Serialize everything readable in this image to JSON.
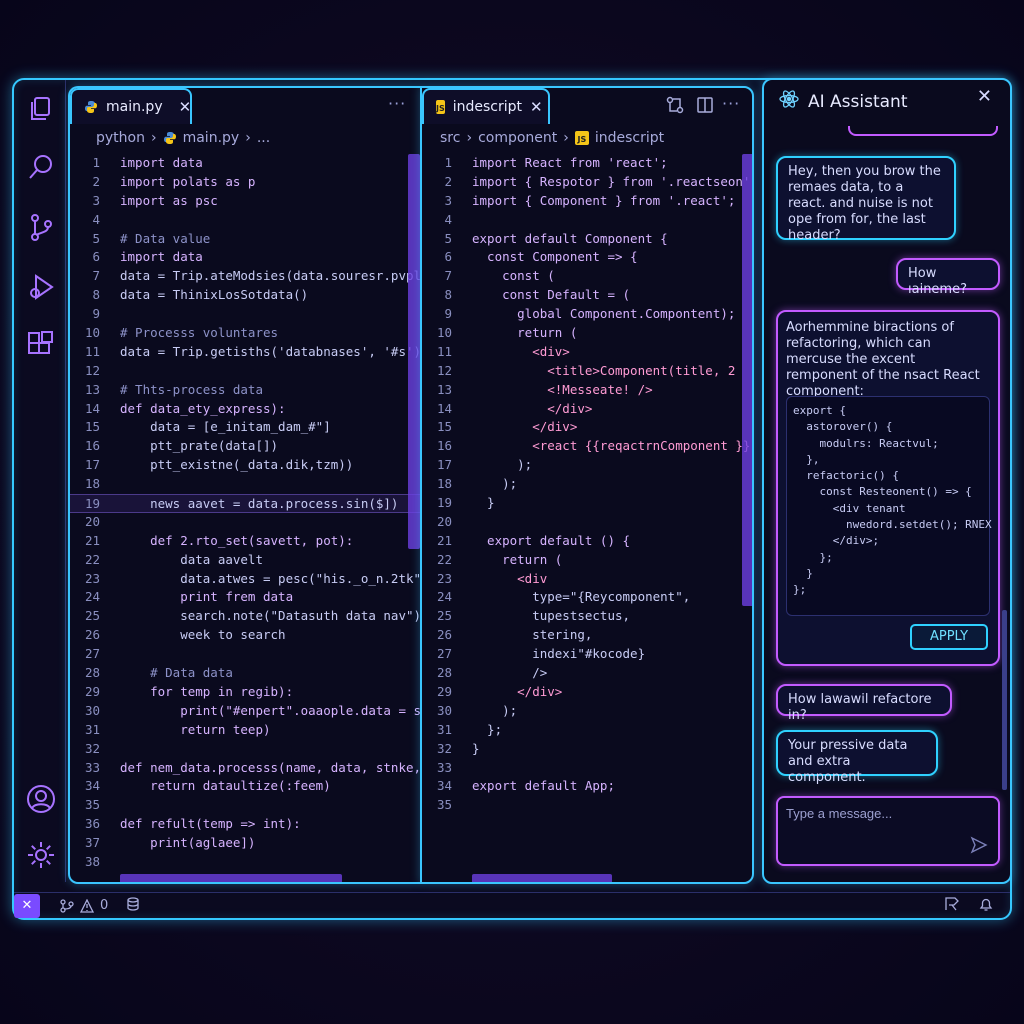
{
  "left_editor": {
    "tab_label": "main.py",
    "close_glyph": "✕",
    "more_glyph": "···",
    "breadcrumb": [
      "python",
      "›",
      "main.py",
      "›",
      "..."
    ],
    "lines": [
      {
        "n": "1",
        "t": "import data"
      },
      {
        "n": "2",
        "t": "import polats as p"
      },
      {
        "n": "3",
        "t": "import as psc"
      },
      {
        "n": "4",
        "t": ""
      },
      {
        "n": "5",
        "t": "# Data value"
      },
      {
        "n": "6",
        "t": "import data"
      },
      {
        "n": "7",
        "t": "data = Trip.ateModsies(data.souresr.pvpl"
      },
      {
        "n": "8",
        "t": "data = ThinixLosSotdata()"
      },
      {
        "n": "9",
        "t": ""
      },
      {
        "n": "10",
        "t": "# Processs voluntares"
      },
      {
        "n": "11",
        "t": "data = Trip.getisths('databnases', '#s')"
      },
      {
        "n": "12",
        "t": ""
      },
      {
        "n": "13",
        "t": "# Thts-process data"
      },
      {
        "n": "14",
        "t": "def data_ety_express):"
      },
      {
        "n": "15",
        "t": "    data = [e_initam_dam_#\"]"
      },
      {
        "n": "16",
        "t": "    ptt_prate(data[])"
      },
      {
        "n": "17",
        "t": "    ptt_existne(_data.dik,tzm))"
      },
      {
        "n": "18",
        "t": ""
      },
      {
        "n": "19",
        "t": "    news aavet = data.process.sin($])"
      },
      {
        "n": "20",
        "t": ""
      },
      {
        "n": "21",
        "t": "    def 2.rto_set(savett, pot):"
      },
      {
        "n": "22",
        "t": "        data aavelt"
      },
      {
        "n": "23",
        "t": "        data.atwes = pesc(\"his._o_n.2tk\""
      },
      {
        "n": "24",
        "t": "        print frem data"
      },
      {
        "n": "25",
        "t": "        search.note(\"Datasuth data nav\")"
      },
      {
        "n": "26",
        "t": "        week to search"
      },
      {
        "n": "27",
        "t": ""
      },
      {
        "n": "28",
        "t": "    # Data data"
      },
      {
        "n": "29",
        "t": "    for temp in regib):"
      },
      {
        "n": "30",
        "t": "        print(\"#enpert\".oaaople.data = str"
      },
      {
        "n": "31",
        "t": "        return teep)"
      },
      {
        "n": "32",
        "t": ""
      },
      {
        "n": "33",
        "t": "def nem_data.processs(name, data, stnke,P"
      },
      {
        "n": "34",
        "t": "    return dataultize(:feem)"
      },
      {
        "n": "35",
        "t": ""
      },
      {
        "n": "36",
        "t": "def refult(temp => int):"
      },
      {
        "n": "37",
        "t": "    print(aglaee])"
      },
      {
        "n": "38",
        "t": ""
      }
    ]
  },
  "right_editor": {
    "tab_label": "indescript",
    "js_badge": "JS",
    "close_glyph": "✕",
    "more_glyph": "···",
    "breadcrumb": [
      "src",
      "›",
      "component",
      "›",
      "indescript"
    ],
    "lines": [
      {
        "n": "1",
        "t": "import React from 'react';"
      },
      {
        "n": "2",
        "t": "import { Respotor } from '.reactseon'"
      },
      {
        "n": "3",
        "t": "import { Component } from '.react';"
      },
      {
        "n": "4",
        "t": ""
      },
      {
        "n": "5",
        "t": "export default Component {"
      },
      {
        "n": "6",
        "t": "  const Component => {"
      },
      {
        "n": "7",
        "t": "    const ("
      },
      {
        "n": "8",
        "t": "    const Default = ("
      },
      {
        "n": "9",
        "t": "      global Component.Compontent);"
      },
      {
        "n": "10",
        "t": "      return ("
      },
      {
        "n": "11",
        "t": "        <div>"
      },
      {
        "n": "12",
        "t": "          <title>Component(title, 2"
      },
      {
        "n": "13",
        "t": "          <!Messeate! />"
      },
      {
        "n": "14",
        "t": "          </div>"
      },
      {
        "n": "15",
        "t": "        </div>"
      },
      {
        "n": "16",
        "t": "        <react {{reqactrnComponent }};"
      },
      {
        "n": "17",
        "t": "      );"
      },
      {
        "n": "18",
        "t": "    );"
      },
      {
        "n": "19",
        "t": "  }"
      },
      {
        "n": "20",
        "t": ""
      },
      {
        "n": "21",
        "t": "  export default () {"
      },
      {
        "n": "22",
        "t": "    return ("
      },
      {
        "n": "23",
        "t": "      <div"
      },
      {
        "n": "24",
        "t": "        type=\"{Reycomponent\","
      },
      {
        "n": "25",
        "t": "        tupestsectus,"
      },
      {
        "n": "26",
        "t": "        stering,"
      },
      {
        "n": "27",
        "t": "        indexi\"#kocode}"
      },
      {
        "n": "28",
        "t": "        />"
      },
      {
        "n": "29",
        "t": "      </div>"
      },
      {
        "n": "30",
        "t": "    );"
      },
      {
        "n": "31",
        "t": "  };"
      },
      {
        "n": "32",
        "t": "}"
      },
      {
        "n": "33",
        "t": ""
      },
      {
        "n": "34",
        "t": "export default App;"
      },
      {
        "n": "35",
        "t": ""
      }
    ]
  },
  "assistant": {
    "title": "AI Assistant",
    "close_glyph": "✕",
    "messages": [
      {
        "text": "Hey, then you brow the remaes data, to a react. and nuise is not ope from for, the last header?"
      },
      {
        "text": "How ıaineme?"
      },
      {
        "text": "Aorhemmine biractions of refactoring, which can mercuse the excent remponent of the nsact React component:"
      },
      {
        "text": "How lawawil refactore in?"
      },
      {
        "text": "Your pressive data and extra component."
      }
    ],
    "snippet_lines": [
      "export {",
      "  astorover() {",
      "    modulrs: Reactvul;",
      "  },",
      "  refactoric() {",
      "    const Resteonent() => {",
      "      <div tenant",
      "        nwedord.setdet(); RNEX",
      "      </div>;",
      "    };",
      "  }",
      "};"
    ],
    "apply_label": "APPLY",
    "input_placeholder": "Type a message..."
  },
  "status": {
    "remote_glyph": "✕",
    "warnings_count": "0"
  },
  "colors": {
    "accent_cyan": "#35c8ff",
    "accent_purple": "#c25bff",
    "scroll_purple": "#6b3fe0"
  }
}
